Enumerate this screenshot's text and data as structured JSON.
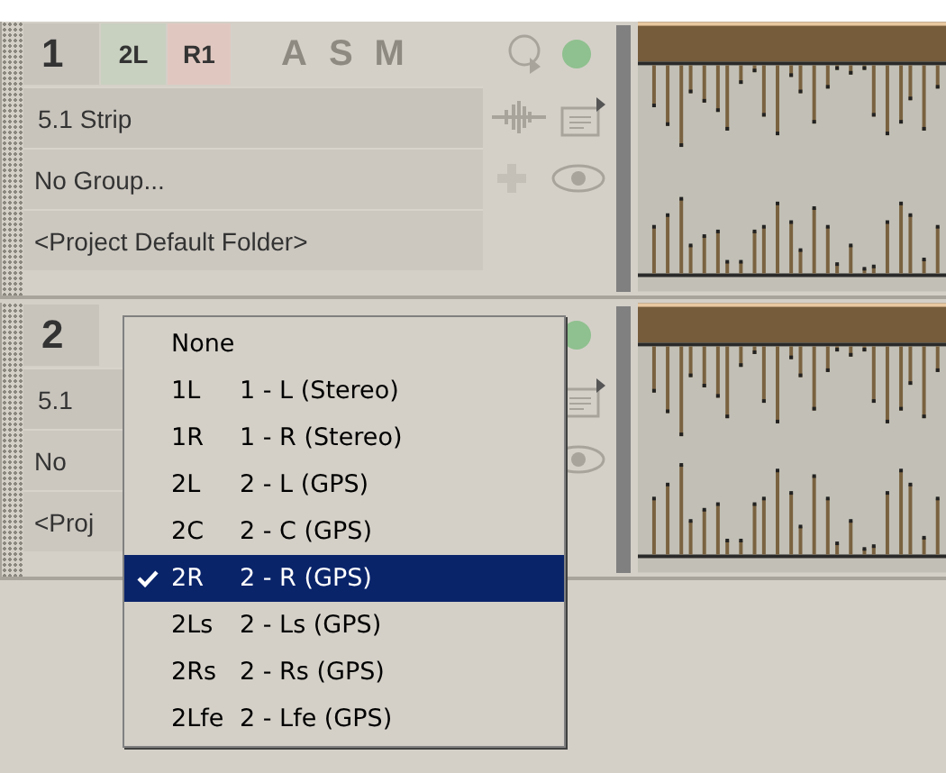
{
  "tracks": [
    {
      "number": "1",
      "input": "2L",
      "output": "R1",
      "buttons": [
        "A",
        "S",
        "M"
      ],
      "armed": true,
      "fields": [
        "5.1 Strip",
        "No Group...",
        "<Project Default Folder>"
      ]
    },
    {
      "number": "2",
      "armed": true,
      "fields": [
        "5.1",
        "No",
        "<Proj"
      ]
    }
  ],
  "menu": {
    "items": [
      {
        "code": "None",
        "checked": false,
        "selected": false
      },
      {
        "code": "1L",
        "label": "1 - L (Stereo)",
        "checked": false,
        "selected": false
      },
      {
        "code": "1R",
        "label": "1 - R (Stereo)",
        "checked": false,
        "selected": false
      },
      {
        "code": "2L",
        "label": "2 - L (GPS)",
        "checked": false,
        "selected": false
      },
      {
        "code": "2C",
        "label": "2 - C (GPS)",
        "checked": false,
        "selected": false
      },
      {
        "code": "2R",
        "label": "2 - R (GPS)",
        "checked": true,
        "selected": true
      },
      {
        "code": "2Ls",
        "label": "2 - Ls (GPS)",
        "checked": false,
        "selected": false
      },
      {
        "code": "2Rs",
        "label": "2 - Rs (GPS)",
        "checked": false,
        "selected": false
      },
      {
        "code": "2Lfe",
        "label": "2 - Lfe (GPS)",
        "checked": false,
        "selected": false
      }
    ]
  }
}
